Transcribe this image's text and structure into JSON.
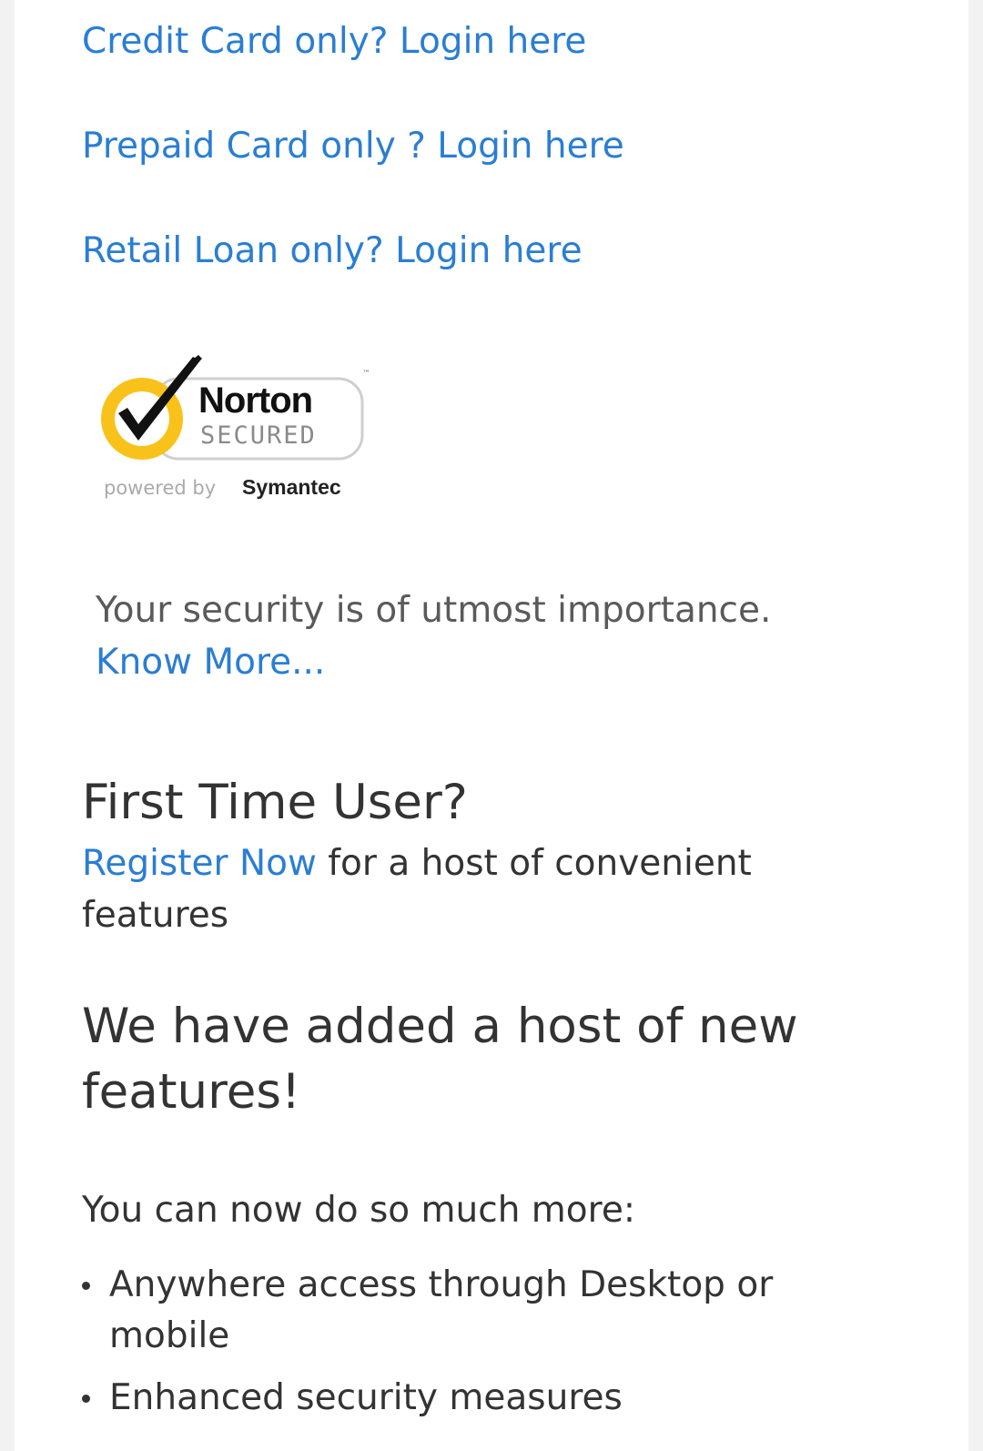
{
  "links": {
    "credit": "Credit Card only? Login here",
    "prepaid": "Prepaid Card only ? Login here",
    "retail": "Retail Loan only? Login here"
  },
  "norton_badge": {
    "brand": "Norton",
    "secured": "SECURED",
    "tm": "™",
    "powered_by": "powered by",
    "company": "Symantec"
  },
  "security": {
    "text": "Your security is of utmost importance.",
    "know_more": "Know More..."
  },
  "first_time": {
    "heading": "First Time User?",
    "register_link": "Register Now",
    "register_suffix": " for a host of convenient features"
  },
  "features": {
    "heading": "We have added a host of new features!",
    "intro": "You can now do so much more:",
    "items": [
      "Anywhere access through Desktop or mobile",
      "Enhanced security measures"
    ]
  },
  "colors": {
    "link": "#2a7ed3",
    "text": "#333333",
    "norton_yellow": "#f9c21a"
  }
}
